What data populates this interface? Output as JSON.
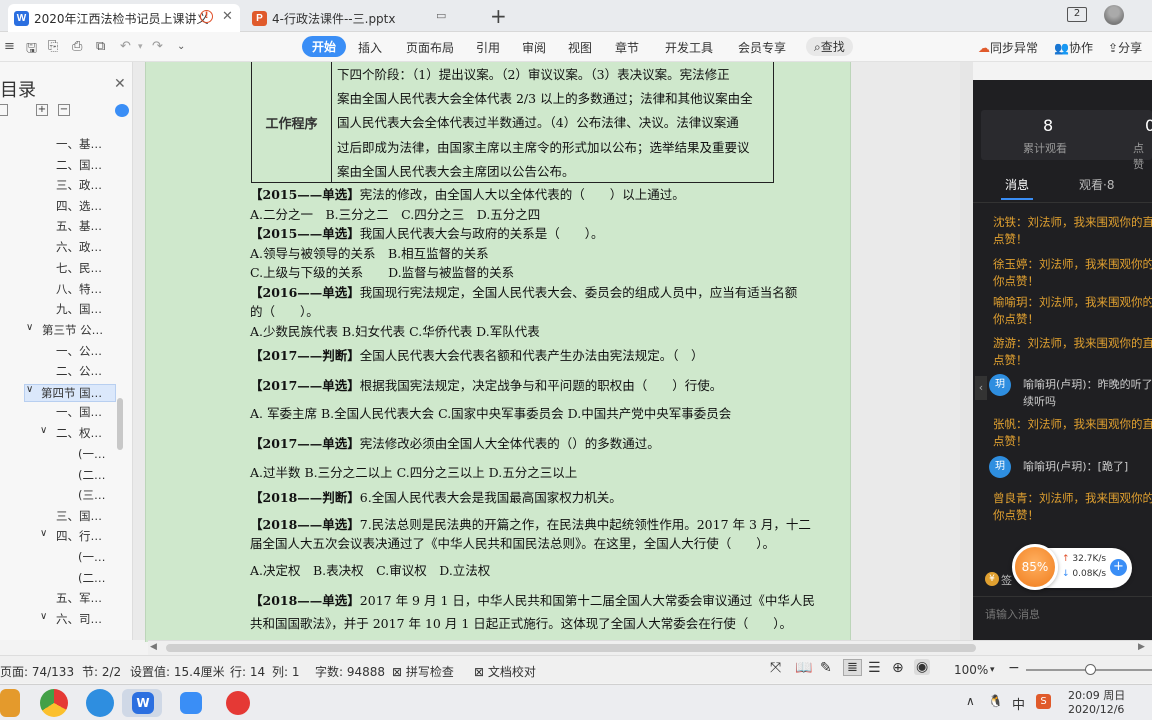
{
  "tabs": [
    {
      "icon": "W",
      "title": "2020年江西法检书记员上课讲义"
    },
    {
      "icon": "P",
      "title": "4-行政法课件--三.pptx"
    }
  ],
  "window": {
    "badge": "2"
  },
  "ribbon": {
    "tabs": [
      "开始",
      "插入",
      "页面布局",
      "引用",
      "审阅",
      "视图",
      "章节",
      "开发工具",
      "会员专享"
    ],
    "search": "查找",
    "right": [
      "同步异常",
      "协作",
      "分享"
    ]
  },
  "nav": {
    "title": "目录",
    "items": [
      "一、基…",
      "二、国…",
      "三、政…",
      "四、选…",
      "五、基…",
      "六、政…",
      "七、民…",
      "八、特…",
      "九、国…",
      "第三节 公…",
      "一、公…",
      "二、公…",
      "第四节 国…",
      "一、国…",
      "二、权…",
      "(一…",
      "(二…",
      "(三…",
      "三、国…",
      "四、行…",
      "(一…",
      "(二…",
      "五、军…",
      "六、司…",
      "(一…"
    ]
  },
  "document": {
    "table": {
      "label": "工作程序",
      "lines": [
        "下四个阶段：（1）提出议案。（2）审议议案。（3）表决议案。宪法修正",
        "案由全国人民代表大会全体代表 2/3 以上的多数通过；法律和其他议案由全",
        "国人民代表大会全体代表过半数通过。（4）公布法律、决议。法律议案通",
        "过后即成为法律，由国家主席以主席令的形式加以公布；选举结果及重要议",
        "案由全国人民代表大会主席团以公告公布。"
      ]
    },
    "questions": [
      {
        "tag": "【2015——单选】",
        "text": "宪法的修改，由全国人大以全体代表的（　　）以上通过。"
      },
      {
        "tag": "",
        "text": "A.二分之一　B.三分之二　C.四分之三　D.五分之四"
      },
      {
        "tag": "【2015——单选】",
        "text": "我国人民代表大会与政府的关系是（　　）。"
      },
      {
        "tag": "",
        "text": "A.领导与被领导的关系　B.相互监督的关系"
      },
      {
        "tag": "",
        "text": "C.上级与下级的关系　　D.监督与被监督的关系"
      },
      {
        "tag": "【2016——单选】",
        "text": "我国现行宪法规定，全国人民代表大会、委员会的组成人员中，应当有适当名额"
      },
      {
        "tag": "",
        "text": "的（　　）。"
      },
      {
        "tag": "",
        "text": " A.少数民族代表 B.妇女代表 C.华侨代表 D.军队代表"
      },
      {
        "tag": "【2017——判断】",
        "text": "全国人民代表大会代表名额和代表产生办法由宪法规定。（　）"
      },
      {
        "tag": "【2017——单选】",
        "text": "根据我国宪法规定，决定战争与和平问题的职权由（　　）行使。"
      },
      {
        "tag": "",
        "text": "A. 军委主席 B.全国人民代表大会 C.国家中央军事委员会 D.中国共产党中央军事委员会"
      },
      {
        "tag": "【2017——单选】",
        "text": "宪法修改必须由全国人大全体代表的（）的多数通过。"
      },
      {
        "tag": "",
        "text": "A.过半数 B.三分之二以上 C.四分之三以上 D.五分之三以上"
      },
      {
        "tag": "【2018——判断】",
        "text": "6.全国人民代表大会是我国最高国家权力机关。"
      },
      {
        "tag": "【2018——单选】",
        "text": "7.民法总则是民法典的开篇之作，在民法典中起统领性作用。2017 年 3 月，十二"
      },
      {
        "tag": "",
        "text": "届全国人大五次会议表决通过了《中华人民共和国民法总则》。在这里，全国人大行使（　　）。"
      },
      {
        "tag": "",
        "text": "A.决定权　B.表决权　C.审议权　D.立法权"
      },
      {
        "tag": "【2018——单选】",
        "text": "2017 年 9 月 1 日，中华人民共和国第十二届全国人大常委会审议通过《中华人民"
      },
      {
        "tag": "",
        "text": "共和国国歌法》，并于 2017 年 10 月 1 日起正式施行。这体现了全国人大常委会在行使（　　）。"
      }
    ]
  },
  "live_panel": {
    "stats": [
      {
        "value": "8",
        "label": "累计观看"
      },
      {
        "value": "0",
        "label": "点赞"
      }
    ],
    "tabs": [
      "消息",
      "观看·8"
    ],
    "messages": [
      {
        "type": "comment",
        "lines": [
          "沈铁：刘法师，我来围观你的直",
          "点赞！"
        ]
      },
      {
        "type": "comment",
        "lines": [
          "徐玉婷：刘法师，我来围观你的",
          "你点赞！"
        ]
      },
      {
        "type": "comment",
        "lines": [
          "喻喻玥：刘法师，我来围观你的",
          "你点赞！"
        ]
      },
      {
        "type": "comment",
        "lines": [
          "游游：刘法师，我来围观你的直",
          "点赞！"
        ]
      },
      {
        "type": "user",
        "avatar": "玥",
        "lines": [
          "喻喻玥(卢玥)：昨晚的听了一",
          "续听吗"
        ]
      },
      {
        "type": "comment",
        "lines": [
          "张帆：刘法师，我来围观你的直",
          "点赞！"
        ]
      },
      {
        "type": "user",
        "avatar": "玥",
        "lines": [
          "喻喻玥(卢玥)：[跪了]"
        ]
      },
      {
        "type": "comment",
        "lines": [
          "曾良青：刘法师，我来围观你的",
          "你点赞！"
        ]
      }
    ],
    "gauge": "85%",
    "up": "32.7K/s",
    "down": "0.08K/s",
    "sign": "签",
    "input_placeholder": "请输入消息"
  },
  "status": {
    "page": "页面: 74/133",
    "section": "节: 2/2",
    "setting": "设置值: 15.4厘米",
    "row": "行: 14",
    "col": "列: 1",
    "words": "字数: 94888",
    "spell": "拼写检查",
    "proof": "文档校对",
    "zoom": "100%"
  },
  "taskbar": {
    "ime": "中",
    "time": "20:09 周日",
    "date": "2020/12/6"
  }
}
